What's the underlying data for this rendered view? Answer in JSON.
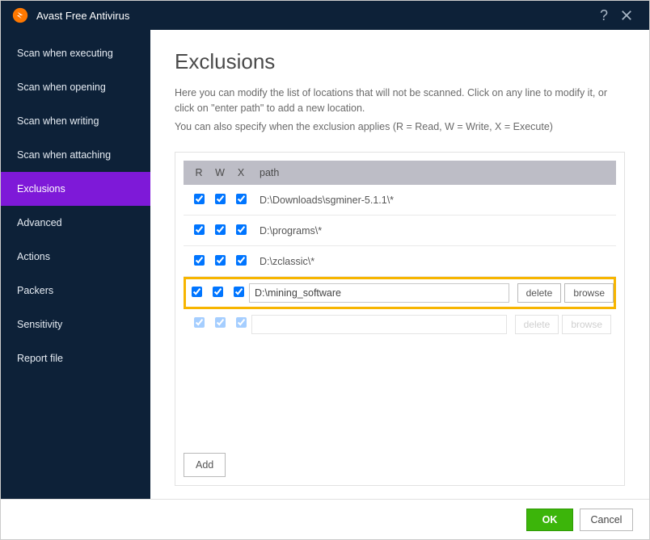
{
  "app_title": "Avast Free Antivirus",
  "sidebar": {
    "items": [
      {
        "label": "Scan when executing",
        "active": false
      },
      {
        "label": "Scan when opening",
        "active": false
      },
      {
        "label": "Scan when writing",
        "active": false
      },
      {
        "label": "Scan when attaching",
        "active": false
      },
      {
        "label": "Exclusions",
        "active": true
      },
      {
        "label": "Advanced",
        "active": false
      },
      {
        "label": "Actions",
        "active": false
      },
      {
        "label": "Packers",
        "active": false
      },
      {
        "label": "Sensitivity",
        "active": false
      },
      {
        "label": "Report file",
        "active": false
      }
    ]
  },
  "page": {
    "title": "Exclusions",
    "desc_line1": "Here you can modify the list of locations that will not be scanned. Click on any line to modify it, or click on \"enter path\" to add a new location.",
    "desc_line2": "You can also specify when the exclusion applies (R = Read, W = Write, X = Execute)"
  },
  "columns": {
    "r": "R",
    "w": "W",
    "x": "X",
    "path": "path"
  },
  "rows": [
    {
      "r": true,
      "w": true,
      "x": true,
      "path": "D:\\Downloads\\sgminer-5.1.1\\*"
    },
    {
      "r": true,
      "w": true,
      "x": true,
      "path": "D:\\programs\\*"
    },
    {
      "r": true,
      "w": true,
      "x": true,
      "path": "D:\\zclassic\\*"
    }
  ],
  "selected_row": {
    "r": true,
    "w": true,
    "x": true,
    "path": "D:\\mining_software",
    "delete_label": "delete",
    "browse_label": "browse"
  },
  "ghost_row": {
    "delete_label": "delete",
    "browse_label": "browse"
  },
  "buttons": {
    "add": "Add",
    "ok": "OK",
    "cancel": "Cancel"
  }
}
